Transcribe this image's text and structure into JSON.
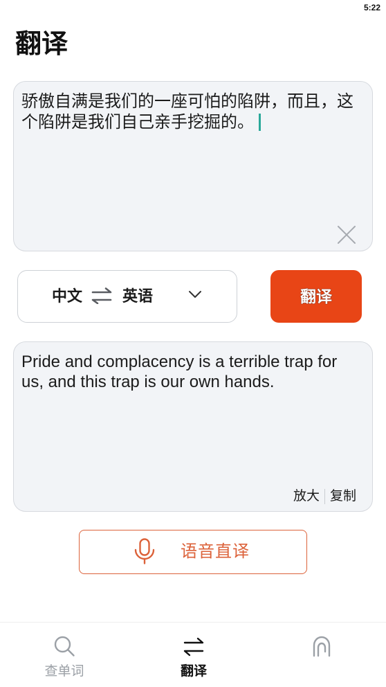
{
  "status_bar": {
    "time": "5:22"
  },
  "header": {
    "title": "翻译"
  },
  "source": {
    "text": "骄傲自满是我们的一座可怕的陷阱，而且，这个陷阱是我们自己亲手挖掘的。",
    "clear_icon": "close-icon"
  },
  "language_selector": {
    "from": "中文",
    "to": "英语",
    "swap_icon": "swap-icon",
    "dropdown_icon": "chevron-down-icon"
  },
  "translate_button": {
    "label": "翻译"
  },
  "output": {
    "text": "Pride and complacency is a terrible trap for us, and this trap is our own hands.",
    "actions": {
      "enlarge": "放大",
      "copy": "复制"
    }
  },
  "voice_button": {
    "label": "语音直译",
    "icon": "microphone-icon"
  },
  "bottom_nav": {
    "items": [
      {
        "label": "查单词",
        "icon": "search-icon",
        "active": false
      },
      {
        "label": "翻译",
        "icon": "swap-arrows-icon",
        "active": true
      },
      {
        "icon": "arch-icon",
        "active": false
      }
    ]
  },
  "colors": {
    "accent": "#e84516",
    "voice_accent": "#dc623a",
    "cursor": "#2aa89a",
    "field_background": "#f2f4f7",
    "nav_active": "#111111",
    "nav_inactive": "#9ba0a6"
  }
}
